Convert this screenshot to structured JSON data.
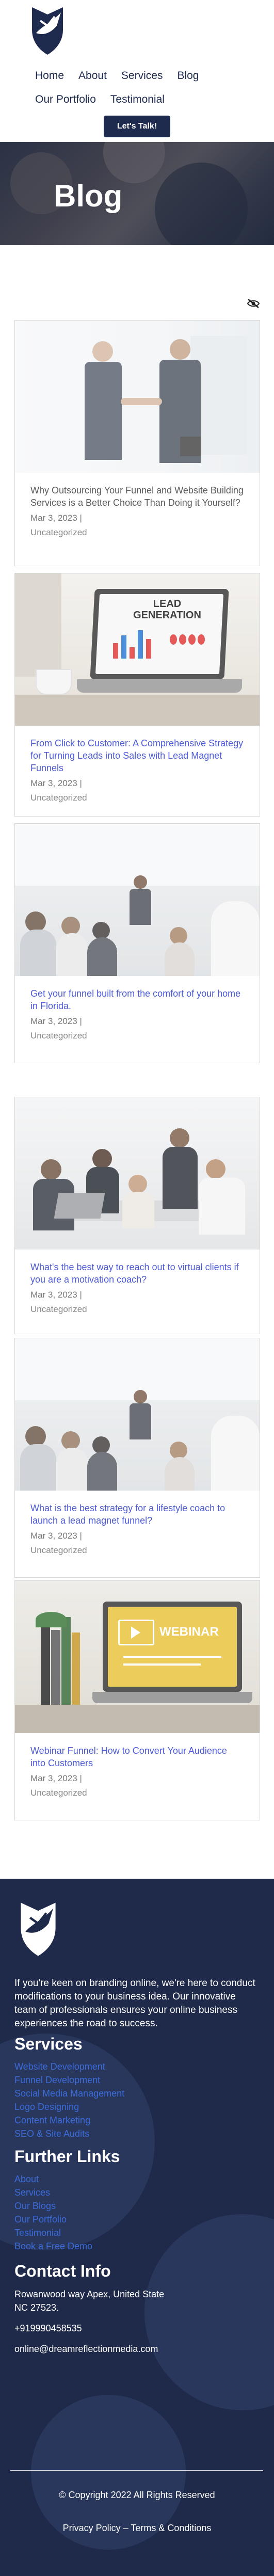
{
  "header": {
    "nav_row1": [
      "Home",
      "About",
      "Services",
      "Blog"
    ],
    "nav_row2": [
      "Our Portfolio",
      "Testimonial"
    ],
    "cta_label": "Let's Talk!"
  },
  "hero": {
    "title": "Blog"
  },
  "posts": [
    {
      "title": "Why Outsourcing Your Funnel and Website Building Services is a Better Choice Than Doing it Yourself?",
      "date": "Mar 3, 2023 |",
      "category": "Uncategorized",
      "title_color": "#5a5a5a"
    },
    {
      "title": "From Click to Customer: A Comprehensive Strategy for Turning Leads into Sales with Lead Magnet Funnels",
      "date": "Mar 3, 2023 |",
      "category": "Uncategorized",
      "title_color": "#4c5ad6",
      "image_text": "LEAD GENERATION"
    },
    {
      "title": "Get your funnel built from the comfort of your home in Florida.",
      "date": "Mar 3, 2023 |",
      "category": "Uncategorized",
      "title_color": "#4c5ad6"
    },
    {
      "title": "What's the best way to reach out to virtual clients if you are a motivation coach?",
      "date": "Mar 3, 2023 |",
      "category": "Uncategorized",
      "title_color": "#4c5ad6"
    },
    {
      "title": "What is the best strategy for a lifestyle coach to launch a lead magnet funnel?",
      "date": "Mar 3, 2023 |",
      "category": "Uncategorized",
      "title_color": "#4c5ad6"
    },
    {
      "title": "Webinar Funnel: How to Convert Your Audience into Customers",
      "date": "Mar 3, 2023 |",
      "category": "Uncategorized",
      "title_color": "#4c5ad6",
      "image_text": "WEBINAR"
    }
  ],
  "footer": {
    "about": "If you're keen on branding online, we're here to conduct modifications to your business idea. Our innovative team of professionals ensures your online business experiences the road to success.",
    "services_heading": "Services",
    "services": [
      "Website Development",
      "Funnel Development",
      "Social Media Management",
      "Logo Designing",
      "Content Marketing",
      "SEO & Site Audits"
    ],
    "links_heading": "Further Links",
    "links": [
      "About",
      "Services",
      "Our Blogs",
      "Our Portfolio",
      "Testimonial",
      "Book a Free Demo"
    ],
    "contact_heading": "Contact Info",
    "address": "Rowanwood way Apex, United State NC 27523.",
    "phone": "+919990458535",
    "email": "online@dreamreflectionmedia.com",
    "copyright": "© Copyright 2022 All Rights Reserved",
    "legal": "Privacy Policy – Terms & Conditions"
  },
  "colors": {
    "navy": "#1e2b4f",
    "link_blue": "#4c5ad6",
    "footer_bg": "#1f2a4a"
  }
}
